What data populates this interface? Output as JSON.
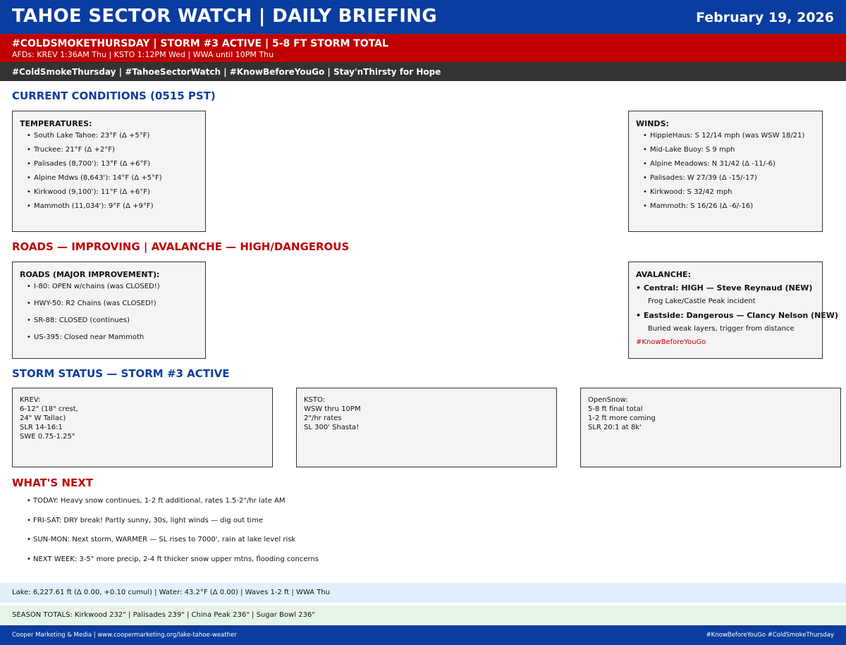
{
  "header": {
    "title": "TAHOE SECTOR WATCH | DAILY BRIEFING",
    "date": "February 19, 2026"
  },
  "alert": {
    "headline": "#COLDSMOKETHURSDAY | STORM #3 ACTIVE | 5-8 FT STORM TOTAL",
    "sub": "AFDs: KREV 1:36AM Thu | KSTO 1:12PM Wed | WWA until 10PM Thu"
  },
  "hashtags": "#ColdSmokeThursday | #TahoeSectorWatch | #KnowBeforeYouGo | Stay'nThirsty for Hope",
  "conditions": {
    "heading": "CURRENT CONDITIONS (0515 PST)",
    "temperatures": {
      "title": "TEMPERATURES:",
      "items": [
        "South Lake Tahoe: 23°F (Δ +5°F)",
        "Truckee: 21°F (Δ +2°F)",
        "Palisades (8,700'): 13°F (Δ +6°F)",
        "Alpine Mdws (8,643'): 14°F (Δ +5°F)",
        "Kirkwood (9,100'): 11°F (Δ +6°F)",
        "Mammoth (11,034'): 9°F (Δ +9°F)"
      ]
    },
    "winds": {
      "title": "WINDS:",
      "items": [
        "HippieHaus: S 12/14 mph (was WSW 18/21)",
        "Mid-Lake Buoy: S 9 mph",
        "Alpine Meadows: N 31/42 (Δ -11/-6)",
        "Palisades: W 27/39 (Δ -15/-17)",
        "Kirkwood: S 32/42 mph",
        "Mammoth: S 16/26 (Δ -6/-16)"
      ]
    }
  },
  "roads_avy": {
    "heading": "ROADS — IMPROVING | AVALANCHE — HIGH/DANGEROUS",
    "roads": {
      "title": "ROADS (MAJOR IMPROVEMENT):",
      "items": [
        "I-80: OPEN w/chains (was CLOSED!)",
        "HWY-50: R2 Chains (was CLOSED!)",
        "SR-88: CLOSED (continues)",
        "US-395: Closed near Mammoth"
      ]
    },
    "avalanche": {
      "title": "AVALANCHE:",
      "central": "• Central: HIGH — Steve Reynaud (NEW)",
      "central_detail": "Frog Lake/Castle Peak incident",
      "eastside": "• Eastside: Dangerous — Clancy Nelson (NEW)",
      "eastside_detail": "Buried weak layers, trigger from distance",
      "tag": "#KnowBeforeYouGo"
    }
  },
  "storm": {
    "heading": "STORM STATUS — STORM #3 ACTIVE",
    "krev": [
      "KREV:",
      "6-12\" (18\" crest,",
      "24\" W Tallac)",
      "SLR 14-16:1",
      "SWE 0.75-1.25\""
    ],
    "ksto": [
      "KSTO:",
      "WSW thru 10PM",
      "2\"/hr rates",
      "SL 300' Shasta!"
    ],
    "opensnow": [
      "OpenSnow:",
      "5-8 ft final total",
      "1-2 ft more coming",
      "SLR 20:1 at 8k'"
    ]
  },
  "next": {
    "heading": "WHAT'S NEXT",
    "items": [
      "TODAY: Heavy snow continues, 1-2 ft additional, rates 1.5-2\"/hr late AM",
      "FRI-SAT: DRY break! Partly sunny, 30s, light winds — dig out time",
      "SUN-MON: Next storm, WARMER — SL rises to 7000', rain at lake level risk",
      "NEXT WEEK: 3-5\" more precip, 2-4 ft thicker snow upper mtns, flooding concerns"
    ]
  },
  "lake": "Lake: 6,227.61 ft (Δ 0.00, +0.10 cumul) | Water: 43.2°F (Δ 0.00) | Waves 1-2 ft | WWA Thu",
  "season": "SEASON TOTALS: Kirkwood 232\" | Palisades 239\" | China Peak 236\" | Sugar Bowl 236\"",
  "footer": {
    "left": "Cooper Marketing & Media | www.coopermarketing.org/lake-tahoe-weather",
    "right": "#KnowBeforeYouGo #ColdSmokeThursday"
  },
  "colors": {
    "brand_blue": "#0a3d9f",
    "alert_red": "#c00000",
    "hashtag_bar": "#333333"
  }
}
